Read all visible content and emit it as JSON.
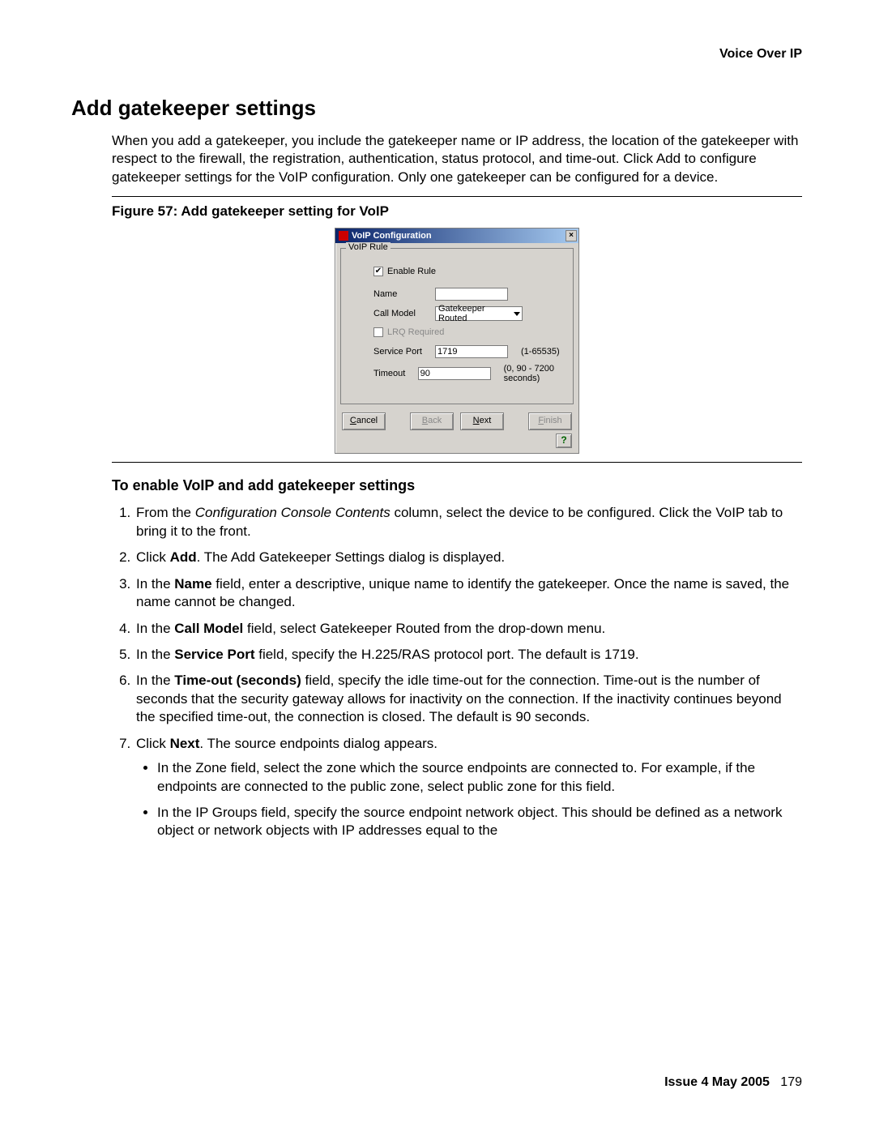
{
  "header": {
    "section": "Voice Over IP"
  },
  "title": "Add gatekeeper settings",
  "intro": "When you add a gatekeeper, you include the gatekeeper name or IP address, the location of the gatekeeper with respect to the firewall, the registration, authentication, status protocol, and time-out. Click Add to configure gatekeeper settings for the VoIP configuration. Only one gatekeeper can be configured for a device.",
  "figure_caption": "Figure 57: Add gatekeeper setting for VoIP",
  "dialog": {
    "title": "VoIP Configuration",
    "close": "×",
    "group_label": "VoIP Rule",
    "enable_label": "Enable Rule",
    "enable_checked": "✔",
    "name_label": "Name",
    "name_value": "",
    "callmodel_label": "Call Model",
    "callmodel_value": "Gatekeeper Routed",
    "lrq_label": "LRQ Required",
    "lrq_checked": "",
    "serviceport_label": "Service Port",
    "serviceport_value": "1719",
    "serviceport_hint": "(1-65535)",
    "timeout_label": "Timeout",
    "timeout_value": "90",
    "timeout_hint": "(0, 90 - 7200 seconds)",
    "buttons": {
      "cancel": "Cancel",
      "back": "Back",
      "next": "Next",
      "finish": "Finish"
    },
    "help": "?"
  },
  "subhead": "To enable VoIP and add gatekeeper settings",
  "steps": {
    "s1a": "From the ",
    "s1_ital": "Configuration Console Contents",
    "s1b": " column, select the device to be configured. Click the VoIP tab to bring it to the front.",
    "s2a": "Click ",
    "s2_bold": "Add",
    "s2b": ". The Add Gatekeeper Settings dialog is displayed.",
    "s3a": "In the ",
    "s3_bold": "Name",
    "s3b": " field, enter a descriptive, unique name to identify the gatekeeper. Once the name is saved, the name cannot be changed.",
    "s4a": "In the ",
    "s4_bold": "Call Model",
    "s4b": " field, select Gatekeeper Routed from the drop-down menu.",
    "s5a": "In the ",
    "s5_bold": "Service Port",
    "s5b": " field, specify the H.225/RAS protocol port. The default is 1719.",
    "s6a": "In the ",
    "s6_bold": "Time-out (seconds)",
    "s6b": " field, specify the idle time-out for the connection. Time-out is the number of seconds that the security gateway allows for inactivity on the connection. If the inactivity continues beyond the specified time-out, the connection is closed. The default is 90 seconds.",
    "s7a": "Click ",
    "s7_bold": "Next",
    "s7b": ". The source endpoints dialog appears.",
    "s7_sub1": "In the Zone field, select the zone which the source endpoints are connected to. For example, if the endpoints are connected to the public zone, select public zone for this field.",
    "s7_sub2": "In the IP Groups field, specify the source endpoint network object. This should be defined as a network object or network objects with IP addresses equal to the"
  },
  "footer": {
    "issue": "Issue 4   May 2005",
    "page": "179"
  }
}
